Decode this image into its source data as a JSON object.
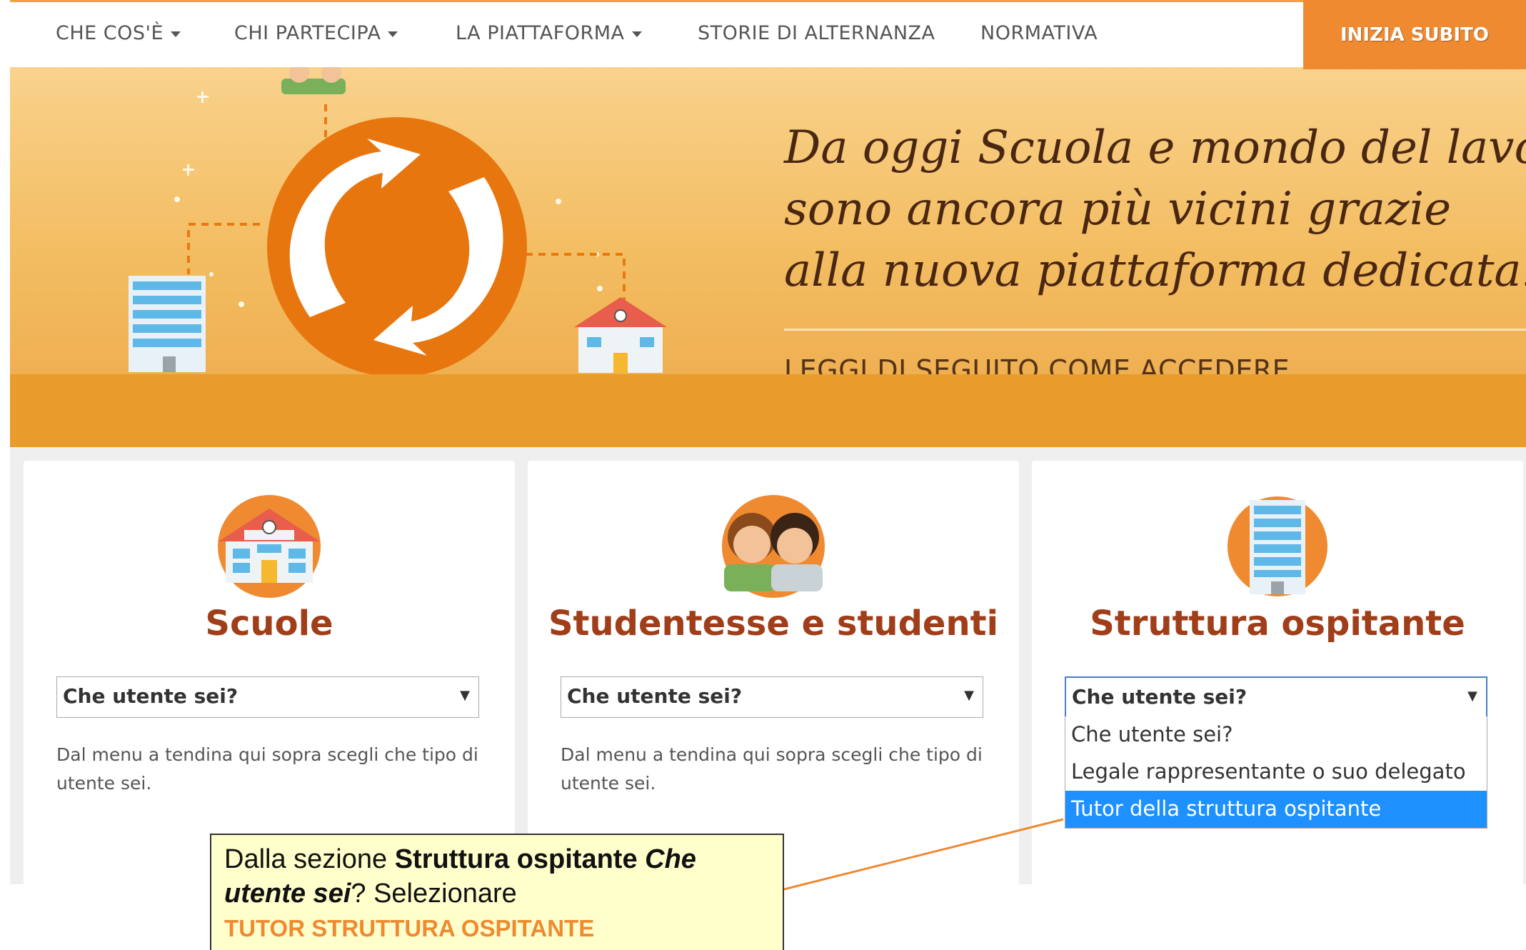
{
  "nav": {
    "items": [
      {
        "label": "CHE COS'È",
        "has_caret": true
      },
      {
        "label": "CHI PARTECIPA",
        "has_caret": true
      },
      {
        "label": "LA PIATTAFORMA",
        "has_caret": true
      },
      {
        "label": "STORIE DI ALTERNANZA",
        "has_caret": false
      },
      {
        "label": "NORMATIVA",
        "has_caret": false
      }
    ],
    "cta_label": "INIZIA SUBITO"
  },
  "hero": {
    "script_lines": [
      "Da oggi Scuola e mondo del lavoro",
      "sono ancora più vicini grazie",
      "alla nuova piattaforma dedicata!"
    ],
    "subtitle": "LEGGI DI SEGUITO COME ACCEDERE"
  },
  "cards": [
    {
      "icon": "school-icon",
      "title": "Scuole",
      "select_value": "Che utente sei?",
      "description": "Dal menu a tendina qui sopra scegli che tipo di utente sei."
    },
    {
      "icon": "students-icon",
      "title": "Studentesse e studenti",
      "select_value": "Che utente sei?",
      "description": "Dal menu a tendina qui sopra scegli che tipo di utente sei."
    },
    {
      "icon": "office-building-icon",
      "title": "Struttura ospitante",
      "select_value": "Che utente sei?",
      "description": ""
    }
  ],
  "dropdown": {
    "options": [
      "Che utente sei?",
      "Legale rappresentante o suo delegato",
      "Tutor della struttura ospitante"
    ],
    "selected_index": 2
  },
  "callout": {
    "prefix": "Dalla sezione ",
    "bold": "Struttura ospitante",
    "italic_bold_1": "Che",
    "italic_bold_2": "utente sei",
    "after": "? Selezionare",
    "highlight": "TUTOR STRUTTURA OSPITANTE"
  },
  "colors": {
    "accent": "#ef8a31",
    "title": "#a13e1a",
    "selected_option": "#1e90ff"
  }
}
